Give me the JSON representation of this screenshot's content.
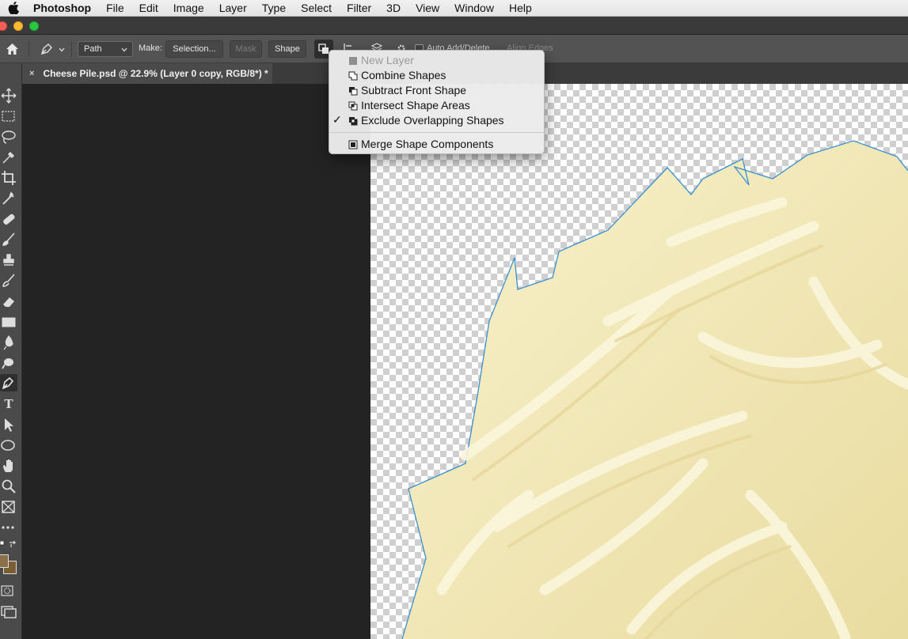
{
  "menubar": {
    "app_name": "Photoshop",
    "items": [
      "File",
      "Edit",
      "Image",
      "Layer",
      "Type",
      "Select",
      "Filter",
      "3D",
      "View",
      "Window",
      "Help"
    ]
  },
  "options_bar": {
    "mode_select": "Path",
    "make_label": "Make:",
    "selection_button": "Selection...",
    "mask_button": "Mask",
    "shape_button": "Shape",
    "auto_add_delete": "Auto Add/Delete",
    "align_edges": "Align Edges"
  },
  "document_tab": {
    "close": "×",
    "title": "Cheese Pile.psd @ 22.9% (Layer 0 copy, RGB/8*) *"
  },
  "path_operations_menu": {
    "items": [
      {
        "label": "New Layer",
        "enabled": false,
        "checked": false,
        "icon": "new-layer-icon"
      },
      {
        "label": "Combine Shapes",
        "enabled": true,
        "checked": false,
        "icon": "combine-shapes-icon"
      },
      {
        "label": "Subtract Front Shape",
        "enabled": true,
        "checked": false,
        "icon": "subtract-front-shape-icon"
      },
      {
        "label": "Intersect Shape Areas",
        "enabled": true,
        "checked": false,
        "icon": "intersect-shape-areas-icon"
      },
      {
        "label": "Exclude Overlapping Shapes",
        "enabled": true,
        "checked": true,
        "icon": "exclude-overlapping-shapes-icon"
      },
      {
        "label": "Merge Shape Components",
        "enabled": true,
        "checked": false,
        "icon": "merge-shape-components-icon"
      }
    ],
    "check_glyph": "✓"
  },
  "toolbar": {
    "type_tool_glyph": "T",
    "colors": {
      "foreground": "#8a6f47",
      "background": "#7a5e35"
    }
  },
  "colors": {
    "workspace": "#232323",
    "cheese": "#f4eab9",
    "path_outline": "#3a8fd0"
  }
}
